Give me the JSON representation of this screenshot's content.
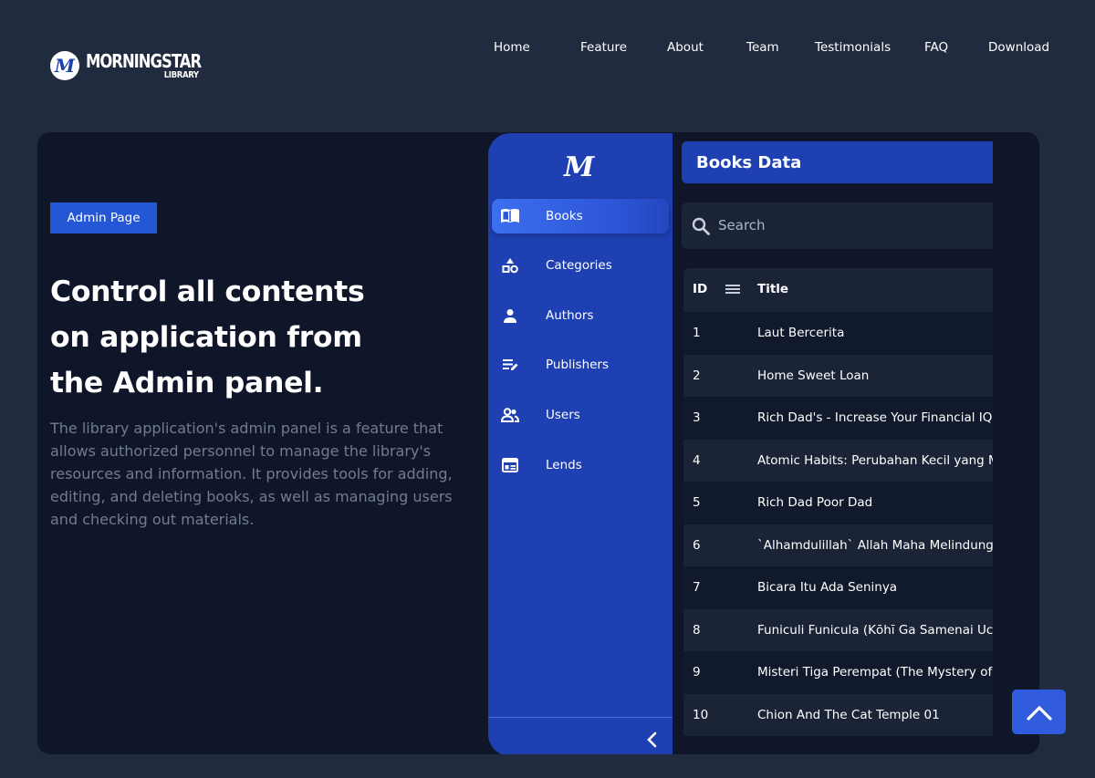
{
  "brand": {
    "badge_letter": "M",
    "name": "MORNINGSTAR",
    "sub": "LIBRARY"
  },
  "nav": [
    {
      "label": "Home"
    },
    {
      "label": "Feature"
    },
    {
      "label": "About"
    },
    {
      "label": "Team"
    },
    {
      "label": "Testimonials"
    },
    {
      "label": "FAQ"
    },
    {
      "label": "Download"
    }
  ],
  "hero": {
    "badge": "Admin Page",
    "headline_lines": [
      "Control all contents",
      "on application from",
      "the Admin panel."
    ],
    "description": "The library application's admin panel is a feature that allows authorized personnel to manage the library's resources and information. It provides tools for adding, editing, and deleting books, as well as managing users and checking out materials."
  },
  "admin": {
    "sidebar_logo": "M",
    "sidebar_items": [
      {
        "label": "Books",
        "icon": "book-open-icon",
        "active": true
      },
      {
        "label": "Categories",
        "icon": "shapes-icon",
        "active": false
      },
      {
        "label": "Authors",
        "icon": "person-icon",
        "active": false
      },
      {
        "label": "Publishers",
        "icon": "edit-list-icon",
        "active": false
      },
      {
        "label": "Users",
        "icon": "users-icon",
        "active": false
      },
      {
        "label": "Lends",
        "icon": "table-icon",
        "active": false
      }
    ],
    "collapse_icon": "chevron-left-icon",
    "title": "Books Data",
    "search_placeholder": "Search",
    "columns": [
      "ID",
      "Title"
    ],
    "rows": [
      {
        "id": "1",
        "title": "Laut Bercerita"
      },
      {
        "id": "2",
        "title": "Home Sweet Loan"
      },
      {
        "id": "3",
        "title": "Rich Dad's - Increase Your Financial IQ"
      },
      {
        "id": "4",
        "title": "Atomic Habits: Perubahan Kecil yang M"
      },
      {
        "id": "5",
        "title": "Rich Dad Poor Dad"
      },
      {
        "id": "6",
        "title": "`Alhamdulillah` Allah Maha Melindungik"
      },
      {
        "id": "7",
        "title": "Bicara Itu Ada Seninya"
      },
      {
        "id": "8",
        "title": "Funiculi Funicula (Kōhī Ga Samenai Uch"
      },
      {
        "id": "9",
        "title": "Misteri Tiga Perempat (The Mystery of T"
      },
      {
        "id": "10",
        "title": "Chion And The Cat Temple 01"
      }
    ]
  },
  "scroll_top_icon": "chevron-up-icon",
  "colors": {
    "page_bg": "#202b3f",
    "card_bg": "#0f1629",
    "accent": "#2457d6",
    "sidebar": "#1f40b2"
  }
}
